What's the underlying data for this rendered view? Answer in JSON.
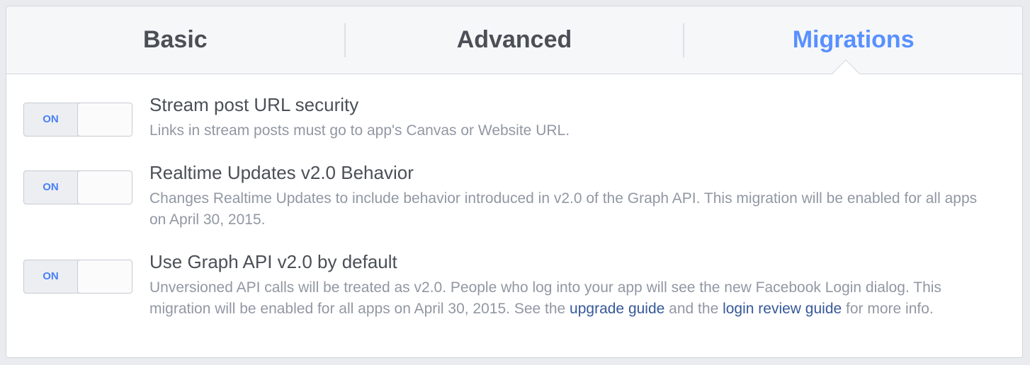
{
  "tabs": {
    "basic": "Basic",
    "advanced": "Advanced",
    "migrations": "Migrations"
  },
  "colors": {
    "active_tab": "#5890ff",
    "tab_text": "#4b4f56",
    "link": "#365899",
    "toggle_on_text": "#4a80f5"
  },
  "migrations": [
    {
      "toggle_label": "ON",
      "toggle_state": "on",
      "title": "Stream post URL security",
      "description": "Links in stream posts must go to app's Canvas or Website URL."
    },
    {
      "toggle_label": "ON",
      "toggle_state": "on",
      "title": "Realtime Updates v2.0 Behavior",
      "description": "Changes Realtime Updates to include behavior introduced in v2.0 of the Graph API. This migration will be enabled for all apps on April 30, 2015."
    },
    {
      "toggle_label": "ON",
      "toggle_state": "on",
      "title": "Use Graph API v2.0 by default",
      "description_part1": "Unversioned API calls will be treated as v2.0. People who log into your app will see the new Facebook Login dialog. This migration will be enabled for all apps on April 30, 2015. See the ",
      "link_upgrade": "upgrade guide",
      "description_part2": " and the ",
      "link_login_review": "login review guide",
      "description_part3": " for more info."
    }
  ]
}
